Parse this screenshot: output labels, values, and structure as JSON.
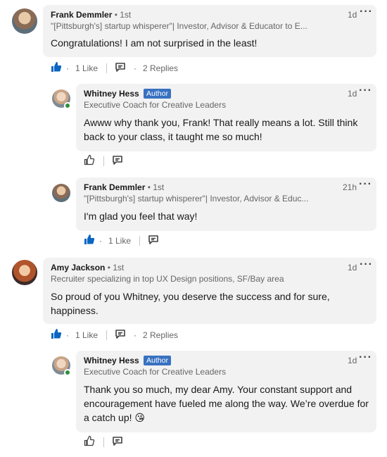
{
  "more_glyph": "···",
  "separator_dot": "·",
  "comments": [
    {
      "name": "Frank Demmler",
      "degree": "• 1st",
      "headline": "\"[Pittsburgh's] startup whisperer\"| Investor, Advisor & Educator to E...",
      "time": "1d",
      "text": "Congratulations! I am not surprised in the least!",
      "likes_label": "1 Like",
      "replies_label": "2 Replies"
    },
    {
      "name": "Whitney Hess",
      "badge": "Author",
      "headline": "Executive Coach for Creative Leaders",
      "time": "1d",
      "text": "Awww why thank you, Frank! That really means a lot. Still think back to your class, it taught me so much!"
    },
    {
      "name": "Frank Demmler",
      "degree": "• 1st",
      "headline": "\"[Pittsburgh's] startup whisperer\"| Investor, Advisor & Educ...",
      "time": "21h",
      "text": "I'm glad you feel that way!",
      "likes_label": "1 Like"
    },
    {
      "name": "Amy Jackson",
      "degree": "• 1st",
      "headline": "Recruiter specializing in top UX Design positions, SF/Bay area",
      "time": "1d",
      "text": "So proud of you Whitney, you deserve the success and for sure, happiness.",
      "likes_label": "1 Like",
      "replies_label": "2 Replies"
    },
    {
      "name": "Whitney Hess",
      "badge": "Author",
      "headline": "Executive Coach for Creative Leaders",
      "time": "1d",
      "text": "Thank you so much, my dear Amy. Your constant support and encouragement have fueled me along the way. We’re overdue for a catch up! 😘"
    }
  ],
  "colors": {
    "like_blue": "#0a66c2",
    "author_badge": "#3871c1",
    "bubble_bg": "#f2f2f2",
    "online_green": "#2e8f3e"
  }
}
